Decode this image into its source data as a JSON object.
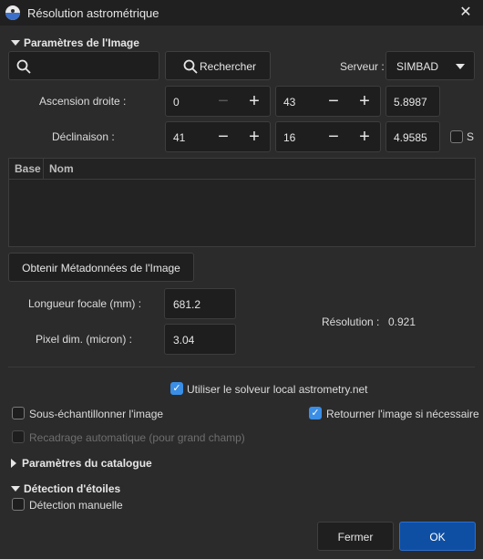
{
  "window": {
    "title": "Résolution astrométrique",
    "close_glyph": "✕"
  },
  "image_params": {
    "header": "Paramètres de l'Image",
    "search_placeholder": "",
    "search_button": "Rechercher",
    "server_label": "Serveur :",
    "server_value": "SIMBAD",
    "ra_label": "Ascension droite :",
    "ra": {
      "hours": "0",
      "minutes": "43",
      "seconds": "5.8987"
    },
    "dec_label": "Déclinaison :",
    "dec": {
      "degrees": "41",
      "minutes": "16",
      "seconds": "4.9585"
    },
    "south_label": "S",
    "table_headers": [
      "Base",
      "Nom"
    ],
    "metadata_button": "Obtenir Métadonnées de l'Image",
    "focal_label": "Longueur focale (mm) :",
    "focal_value": "681.2",
    "pixel_label": "Pixel dim. (micron) :",
    "pixel_value": "3.04",
    "resolution_label": "Résolution :",
    "resolution_value": "0.921"
  },
  "options": {
    "local_solver": {
      "label": "Utiliser le solveur local astrometry.net",
      "checked": true
    },
    "downsample": {
      "label": "Sous-échantillonner l'image",
      "checked": false
    },
    "flip": {
      "label": "Retourner l'image si nécessaire",
      "checked": true
    },
    "autocrop": {
      "label": "Recadrage automatique (pour grand champ)",
      "checked": false,
      "disabled": true
    }
  },
  "catalog": {
    "header": "Paramètres du catalogue"
  },
  "star_detection": {
    "header": "Détection d'étoiles",
    "manual": {
      "label": "Détection manuelle",
      "checked": false
    }
  },
  "buttons": {
    "cancel": "Fermer",
    "ok": "OK"
  },
  "colors": {
    "accent": "#3a8ee6",
    "ok_button": "#0f4fa3",
    "background": "#2b2b2b"
  }
}
